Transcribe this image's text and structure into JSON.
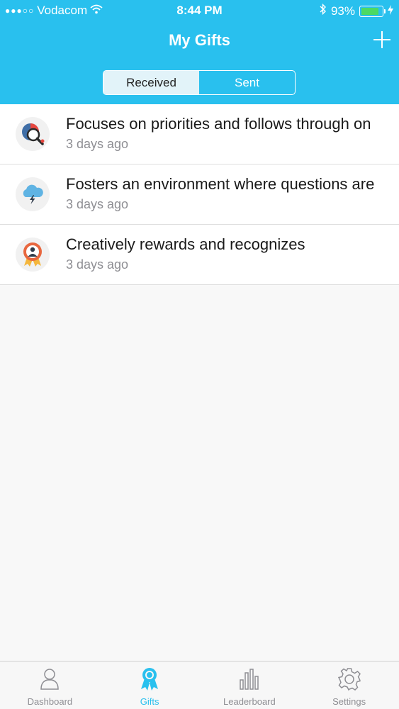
{
  "status_bar": {
    "signal": "●●●○○",
    "carrier": "Vodacom",
    "time": "8:44 PM",
    "battery_percent": "93%",
    "battery_level": 0.93
  },
  "header": {
    "title": "My Gifts",
    "segments": [
      "Received",
      "Sent"
    ]
  },
  "gifts": [
    {
      "title": "Focuses on priorities and follows through on",
      "time": "3 days ago",
      "icon": "priority-chart-icon"
    },
    {
      "title": "Fosters an environment where questions are",
      "time": "3 days ago",
      "icon": "cloud-lightning-icon"
    },
    {
      "title": "Creatively rewards and recognizes",
      "time": "3 days ago",
      "icon": "award-badge-icon"
    }
  ],
  "tabbar": {
    "dashboard": "Dashboard",
    "gifts": "Gifts",
    "leaderboard": "Leaderboard",
    "settings": "Settings"
  },
  "colors": {
    "accent": "#29c0ee",
    "battery": "#4cd964"
  }
}
